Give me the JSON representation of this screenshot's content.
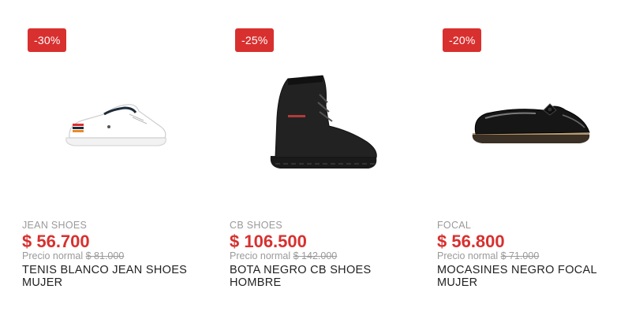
{
  "products": [
    {
      "discount": "-30%",
      "brand": "JEAN SHOES",
      "price": "$ 56.700",
      "normal_label": "Precio normal",
      "normal_price": "$ 81.000",
      "name": "TENIS BLANCO JEAN SHOES MUJER",
      "image_icon": "white-sneaker-image"
    },
    {
      "discount": "-25%",
      "brand": "CB SHOES",
      "price": "$ 106.500",
      "normal_label": "Precio normal",
      "normal_price": "$ 142.000",
      "name": "BOTA NEGRO CB SHOES HOMBRE",
      "image_icon": "black-boot-image"
    },
    {
      "discount": "-20%",
      "brand": "FOCAL",
      "price": "$ 56.800",
      "normal_label": "Precio normal",
      "normal_price": "$ 71.000",
      "name": "MOCASINES NEGRO FOCAL MUJER",
      "image_icon": "black-loafer-image"
    }
  ],
  "colors": {
    "accent": "#d8302f",
    "muted_text": "#9a9a9a",
    "title_text": "#222222"
  }
}
